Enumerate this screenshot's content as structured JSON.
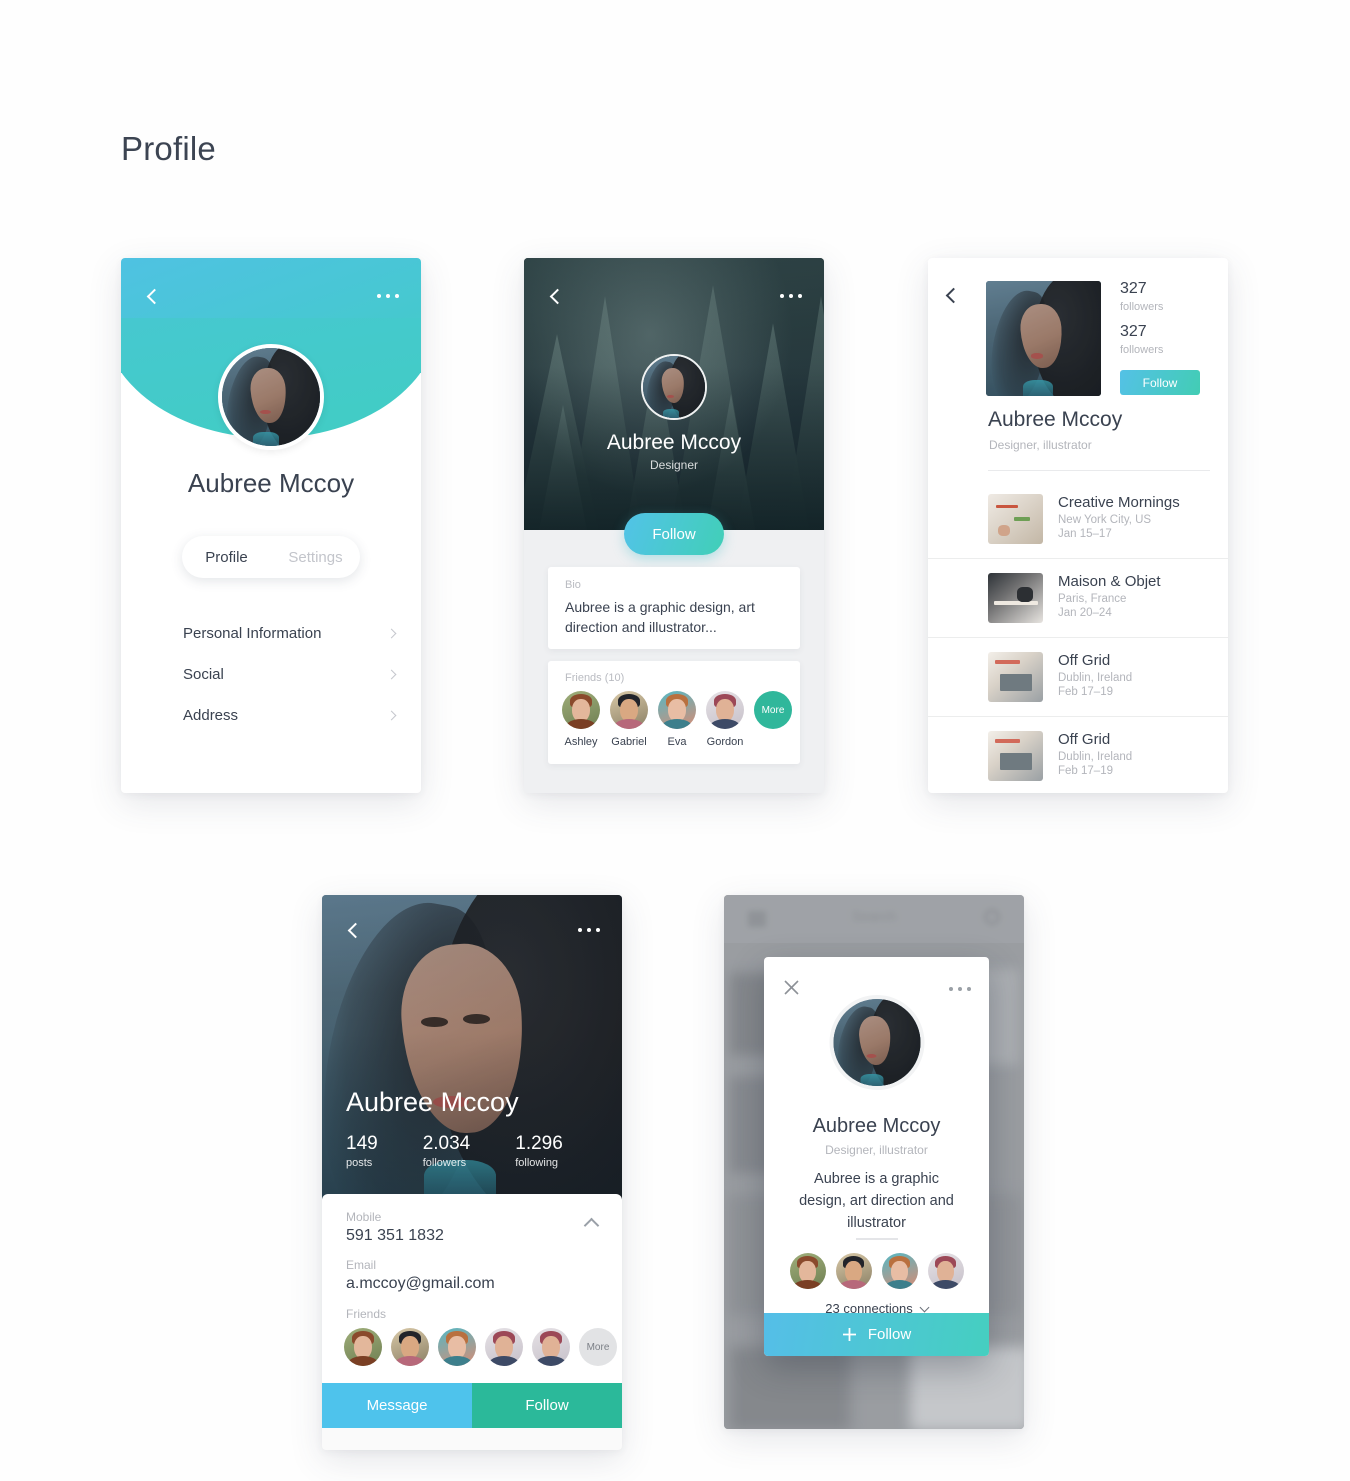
{
  "page": {
    "title": "Profile"
  },
  "colors": {
    "blue": "#4EC3EC",
    "teal": "#2BB99A",
    "grad_from": "#52c3e8",
    "grad_to": "#41cfb7",
    "text_dark": "#3a4250",
    "text_muted": "#b3b5bb"
  },
  "card1": {
    "back_icon": "chevron-left-icon",
    "more_icon": "more-horizontal-icon",
    "name": "Aubree Mccoy",
    "tabs": [
      {
        "label": "Profile",
        "active": true
      },
      {
        "label": "Settings",
        "active": false
      }
    ],
    "menu": [
      {
        "label": "Personal Information",
        "chevron": "chevron-right-icon"
      },
      {
        "label": "Social",
        "chevron": "chevron-right-icon"
      },
      {
        "label": "Address",
        "chevron": "chevron-right-icon"
      }
    ]
  },
  "card2": {
    "back_icon": "chevron-left-icon",
    "more_icon": "more-horizontal-icon",
    "name": "Aubree Mccoy",
    "role": "Designer",
    "follow_label": "Follow",
    "bio_label": "Bio",
    "bio_text": "Aubree is a graphic design, art direction and illustrator...",
    "friends_label": "Friends (10)",
    "friends": [
      {
        "name": "Ashley",
        "key": "ashley"
      },
      {
        "name": "Gabriel",
        "key": "gabriel"
      },
      {
        "name": "Eva",
        "key": "eva"
      },
      {
        "name": "Gordon",
        "key": "gordon"
      }
    ],
    "more_label": "More"
  },
  "card3": {
    "back_icon": "chevron-left-icon",
    "stats": [
      {
        "value": "327",
        "label": "followers"
      },
      {
        "value": "327",
        "label": "followers"
      }
    ],
    "follow_label": "Follow",
    "name": "Aubree Mccoy",
    "role": "Designer, illustrator",
    "events": [
      {
        "title": "Creative Mornings",
        "place": "New York City, US",
        "date": "Jan 15–17"
      },
      {
        "title": "Maison & Objet",
        "place": "Paris, France",
        "date": "Jan 20–24"
      },
      {
        "title": "Off Grid",
        "place": "Dublin, Ireland",
        "date": "Feb 17–19"
      },
      {
        "title": "Off Grid",
        "place": "Dublin, Ireland",
        "date": "Feb 17–19"
      }
    ]
  },
  "card4": {
    "back_icon": "chevron-left-icon",
    "more_icon": "more-horizontal-icon",
    "name": "Aubree Mccoy",
    "stats": [
      {
        "value": "149",
        "label": "posts"
      },
      {
        "value": "2.034",
        "label": "followers"
      },
      {
        "value": "1.296",
        "label": "following"
      }
    ],
    "collapse_icon": "chevron-up-icon",
    "mobile_label": "Mobile",
    "mobile_value": "591 351 1832",
    "email_label": "Email",
    "email_value": "a.mccoy@gmail.com",
    "friends_label": "Friends",
    "friends": [
      {
        "key": "ashley"
      },
      {
        "key": "gabriel"
      },
      {
        "key": "eva"
      },
      {
        "key": "gordon"
      },
      {
        "key": "gordon"
      }
    ],
    "more_label": "More",
    "message_label": "Message",
    "follow_label": "Follow"
  },
  "card5": {
    "background_search_placeholder": "Search",
    "close_icon": "close-icon",
    "more_icon": "more-horizontal-icon",
    "name": "Aubree Mccoy",
    "role": "Designer, illustrator",
    "bio_text": "Aubree is a graphic design, art direction and illustrator",
    "friends": [
      {
        "key": "ashley"
      },
      {
        "key": "gabriel"
      },
      {
        "key": "eva"
      },
      {
        "key": "gordon"
      }
    ],
    "connections_label": "23 connections",
    "connections_chevron": "chevron-down-icon",
    "follow_label": "Follow",
    "follow_plus_icon": "plus-icon"
  }
}
